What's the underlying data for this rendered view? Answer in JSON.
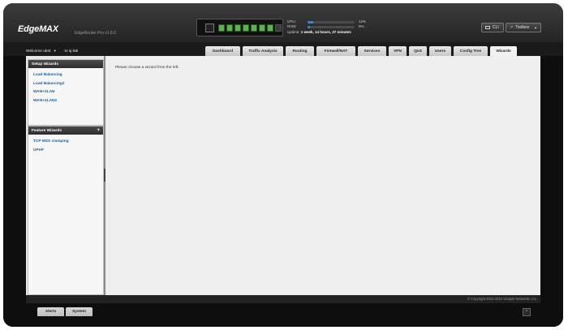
{
  "header": {
    "logo": "EdgeMAX",
    "product": "EdgeRouter Pro v1.8.0",
    "stats": {
      "cpu_label": "CPU:",
      "cpu_pct": "12%",
      "ram_label": "RAM:",
      "ram_pct": "5%",
      "cpu_fill": 0.12,
      "ram_fill": 0.05,
      "uptime_label": "Uptime:",
      "uptime_value": "1 week, 14 hours, 37 minutes"
    },
    "cli_label": "CLI",
    "toolbox_label": "Toolbox"
  },
  "nav": {
    "welcome": "Welcome ubnt",
    "host": "to sj-lab",
    "tabs": [
      "Dashboard",
      "Traffic Analysis",
      "Routing",
      "Firewall/NAT",
      "Services",
      "VPN",
      "QoS",
      "Users",
      "Config Tree",
      "Wizards"
    ],
    "active_tab": "Wizards"
  },
  "sidebar": {
    "setup_title": "Setup Wizards",
    "setup_items": [
      "Load Balancing",
      "Load Balancing2",
      "WAN+2LAN",
      "WAN+2LAN2"
    ],
    "feature_title": "Feature Wizards",
    "feature_plus": "+",
    "feature_items": [
      "TCP MSS clamping",
      "UPnP"
    ]
  },
  "main": {
    "message": "Please choose a wizard from the left."
  },
  "footer": {
    "copyright": "© Copyright 2012-2015 Ubiquiti Networks, Inc."
  },
  "bottom_tabs": [
    "Alerts",
    "System"
  ],
  "collapse_glyph": "^"
}
